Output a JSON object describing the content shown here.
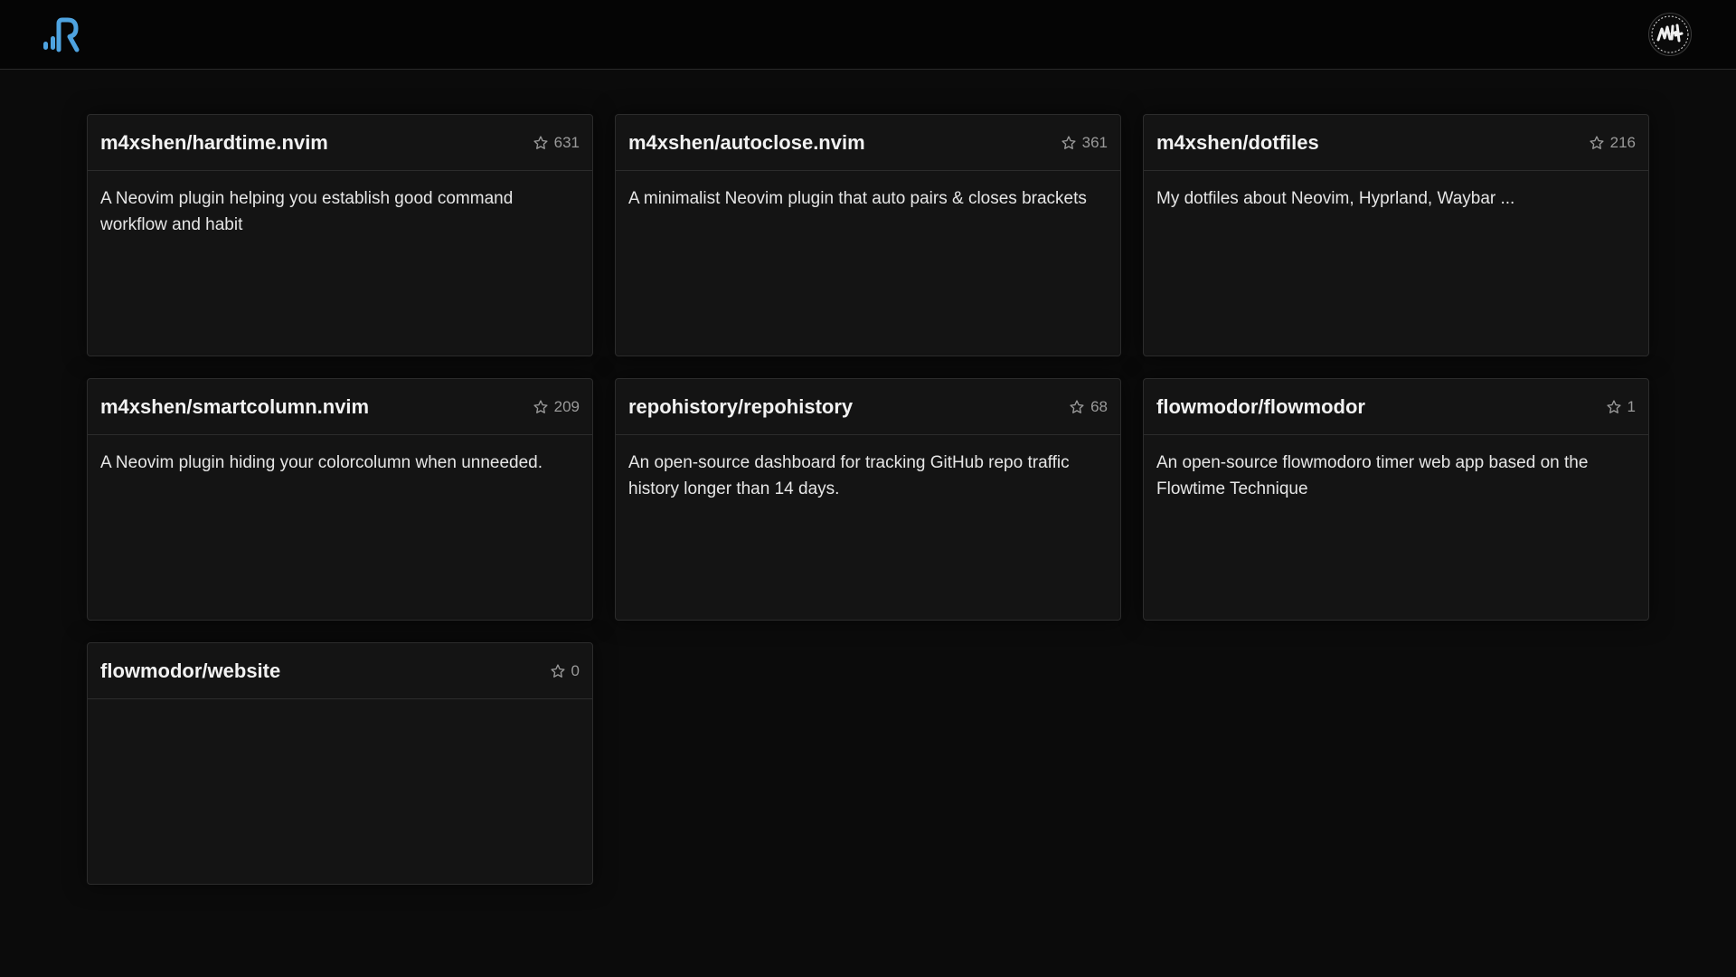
{
  "header": {
    "logo_icon": "repohistory-logo-icon",
    "avatar_icon": "user-avatar-icon",
    "accent_color": "#4ea3e0"
  },
  "repos": [
    {
      "name": "m4xshen/hardtime.nvim",
      "stars": "631",
      "description": "A Neovim plugin helping you establish good command workflow and habit"
    },
    {
      "name": "m4xshen/autoclose.nvim",
      "stars": "361",
      "description": "A minimalist Neovim plugin that auto pairs & closes brackets"
    },
    {
      "name": "m4xshen/dotfiles",
      "stars": "216",
      "description": "My dotfiles about Neovim, Hyprland, Waybar ..."
    },
    {
      "name": "m4xshen/smartcolumn.nvim",
      "stars": "209",
      "description": "A Neovim plugin hiding your colorcolumn when unneeded."
    },
    {
      "name": "repohistory/repohistory",
      "stars": "68",
      "description": "An open-source dashboard for tracking GitHub repo traffic history longer than 14 days."
    },
    {
      "name": "flowmodor/flowmodor",
      "stars": "1",
      "description": "An open-source flowmodoro timer web app based on the Flowtime Technique"
    },
    {
      "name": "flowmodor/website",
      "stars": "0",
      "description": ""
    }
  ]
}
